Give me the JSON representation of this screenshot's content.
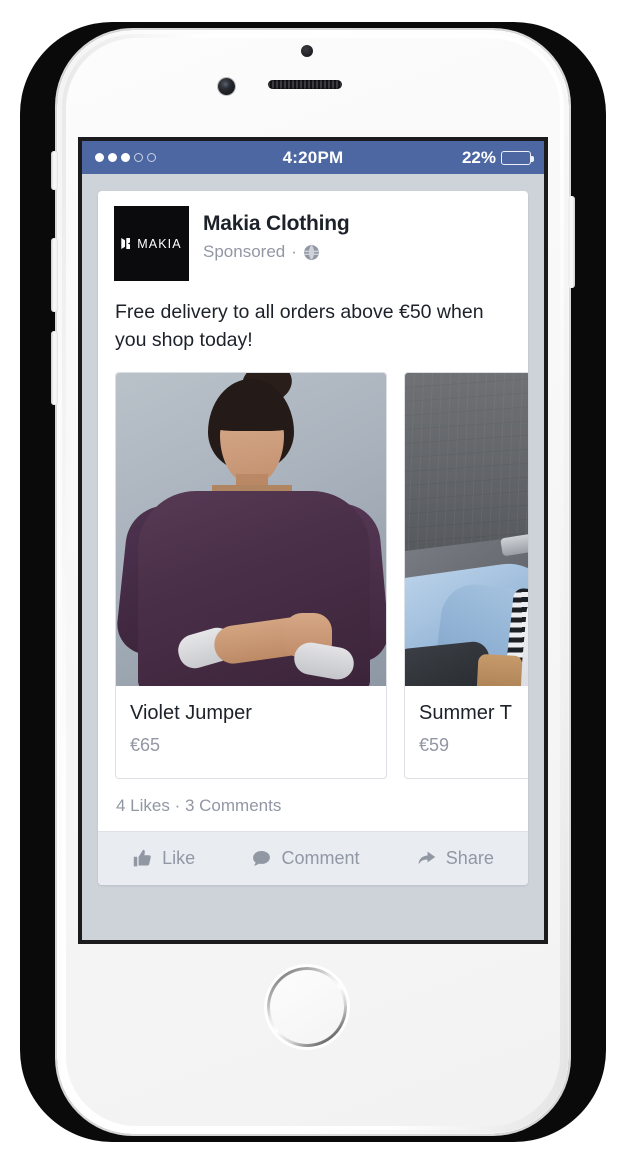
{
  "device": {
    "type": "white-smartphone",
    "home_button": "home-button"
  },
  "status_bar": {
    "signal_dots_filled": 3,
    "signal_dots_total": 5,
    "time": "4:20PM",
    "battery_percent": "22%",
    "battery_level": 22,
    "background_color": "#4c67a1"
  },
  "post": {
    "brand": {
      "logo_text": "MAKIA",
      "logo_background": "#0b0b0d"
    },
    "page_name": "Makia Clothing",
    "sponsored_label": "Sponsored",
    "separator": "·",
    "audience_icon": "globe-icon",
    "copy": "Free delivery to all orders above €50 when you shop today!",
    "carousel": [
      {
        "title": "Violet Jumper",
        "price": "€65",
        "image_alt": "model-in-violet-jumper"
      },
      {
        "title": "Summer T",
        "price": "€59",
        "image_alt": "denim-clothing-rack"
      }
    ],
    "engagement": "4 Likes  ·  3 Comments",
    "actions": [
      {
        "label": "Like",
        "icon": "thumbs-up-icon"
      },
      {
        "label": "Comment",
        "icon": "speech-bubble-icon"
      },
      {
        "label": "Share",
        "icon": "share-arrow-icon"
      }
    ]
  },
  "colors": {
    "facebook_blue": "#4c67a1",
    "feed_background": "#ced3da",
    "card_background": "#ffffff",
    "primary_text": "#1d2129",
    "muted_text": "#9197a3",
    "action_bar": "#e9edf2"
  }
}
